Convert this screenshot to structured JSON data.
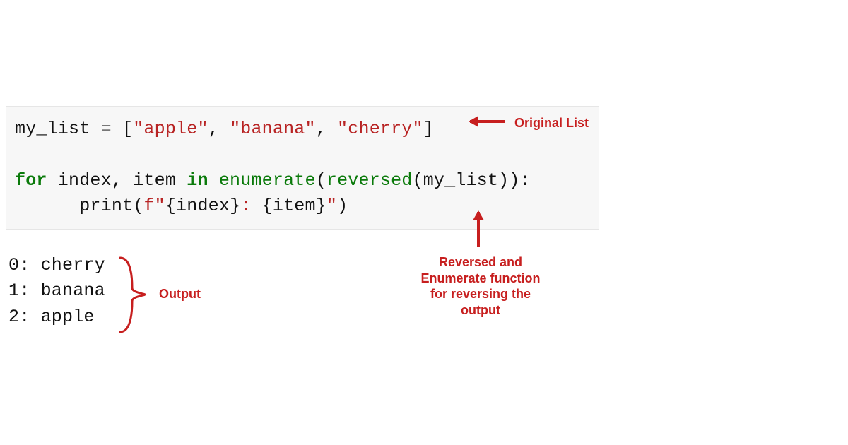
{
  "code": {
    "line1": {
      "var": "my_list",
      "assign": " = ",
      "open": "[",
      "s1": "\"apple\"",
      "c1": ", ",
      "s2": "\"banana\"",
      "c2": ", ",
      "s3": "\"cherry\"",
      "close": "]"
    },
    "line2_blank": "",
    "line3": {
      "kw_for": "for",
      "s1": " index",
      "comma": ", ",
      "s2": "item ",
      "kw_in": "in",
      "s3": " ",
      "fn1": "enumerate",
      "open1": "(",
      "fn2": "reversed",
      "open2": "(",
      "arg": "my_list",
      "close2": ")",
      "close1": ")",
      "colon": ":"
    },
    "line4": {
      "indent": "      ",
      "fn": "print",
      "open": "(",
      "fstr_open": "f\"",
      "brace_o1": "{",
      "v1": "index",
      "brace_c1": "}",
      "mid": ": ",
      "brace_o2": "{",
      "v2": "item",
      "brace_c2": "}",
      "fstr_close": "\"",
      "close": ")"
    }
  },
  "output": {
    "l1": "0: cherry",
    "l2": "1: banana",
    "l3": "2: apple"
  },
  "annotations": {
    "original_list": "Original List",
    "reversed_note": "Reversed and Enumerate function for reversing the output",
    "output": "Output"
  }
}
